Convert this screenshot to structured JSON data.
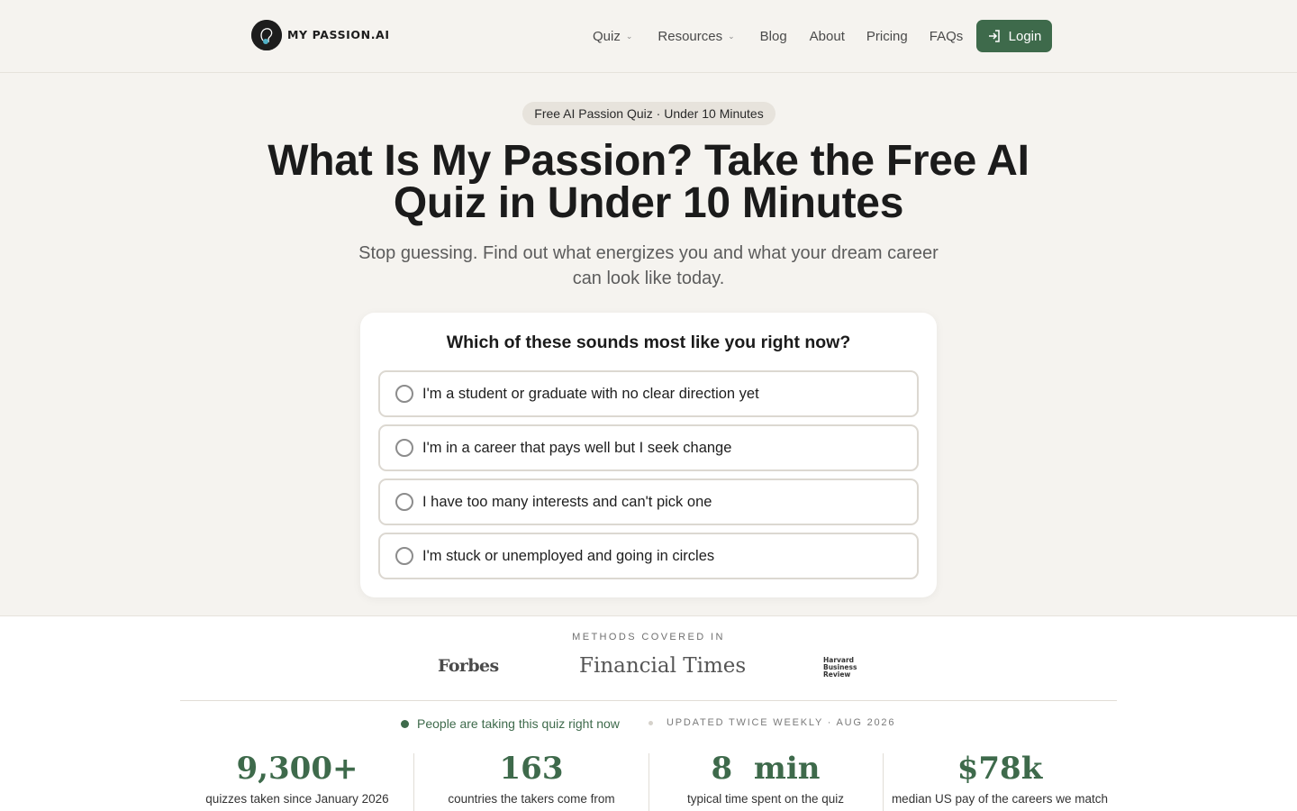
{
  "header": {
    "logo_text": "MY PASSION.AI",
    "nav": [
      {
        "label": "Quiz",
        "has_dropdown": true
      },
      {
        "label": "Resources",
        "has_dropdown": true
      },
      {
        "label": "Blog",
        "has_dropdown": false
      },
      {
        "label": "About",
        "has_dropdown": false
      },
      {
        "label": "Pricing",
        "has_dropdown": false
      },
      {
        "label": "FAQs",
        "has_dropdown": false
      }
    ],
    "login_label": "Login",
    "login_icon": "login-icon"
  },
  "hero": {
    "pill": "Free AI Passion Quiz · Under 10 Minutes",
    "title": "What Is My Passion? Take the Free AI Quiz in Under 10 Minutes",
    "subtitle": "Stop guessing. Find out what energizes you and what your dream career can look like today."
  },
  "quiz": {
    "question": "Which of these sounds most like you right now?",
    "options": [
      "I'm a student or graduate with no clear direction yet",
      "I'm in a career that pays well but I seek change",
      "I have too many interests and can't pick one",
      "I'm stuck or unemployed and going in circles"
    ]
  },
  "press": {
    "label": "METHODS COVERED IN",
    "logos": [
      "Forbes",
      "Financial Times",
      "Harvard Business Review"
    ]
  },
  "live": {
    "text": "People are taking this quiz right now",
    "updated": "UPDATED TWICE WEEKLY · AUG 2026"
  },
  "stats": [
    {
      "value": "9,300+",
      "label": "quizzes taken since January 2026"
    },
    {
      "value": "163",
      "label": "countries the takers come from"
    },
    {
      "value": "8  min",
      "label": "typical time spent on the quiz"
    },
    {
      "value": "$78k",
      "label": "median US pay of the careers we match"
    }
  ],
  "colors": {
    "accent": "#3e6a4b",
    "hero_bg": "#f5f3ef",
    "text": "#1b1b1b"
  }
}
